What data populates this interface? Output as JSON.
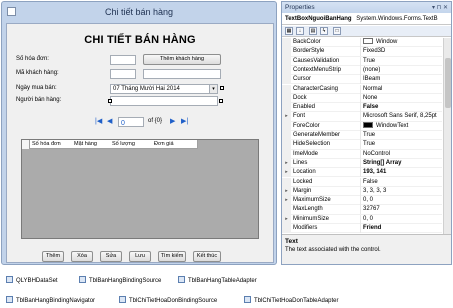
{
  "form": {
    "title": "Chi tiết bán hàng",
    "heading": "CHI TIẾT BÁN HÀNG",
    "labels": {
      "so_hoa_don": "Số hóa đơn:",
      "ma_khach_hang": "Mã khách hàng:",
      "ngay_mua_ban": "Ngày mua bán:",
      "nguoi_ban_hang": "Người bán hàng:"
    },
    "add_customer_button": "Thêm khách hàng",
    "date_value": "07 Tháng Mười Hai 2014",
    "navigator": {
      "position": "0",
      "count": "of {0}"
    },
    "grid_columns": [
      "Số hóa đơn",
      "Mặt hàng",
      "Số lượng",
      "Đơn giá"
    ],
    "buttons": [
      "Thêm",
      "Xóa",
      "Sửa",
      "Lưu",
      "Tìm kiếm",
      "Kết thúc"
    ]
  },
  "tray": {
    "items": [
      "QLYBHDataSet",
      "TblBanHangBindingSource",
      "TblBanHangTableAdapter",
      "TblBanHangBindingNavigator",
      "TblChiTietHoaDonBindingSource",
      "TblChiTietHoaDonTableAdapter"
    ]
  },
  "properties": {
    "title": "Properties",
    "object_name": "TextBoxNguoiBanHang",
    "object_type": "System.Windows.Forms.TextB",
    "rows": [
      {
        "name": "BackColor",
        "value": "Window",
        "swatch": "#ffffff"
      },
      {
        "name": "BorderStyle",
        "value": "Fixed3D"
      },
      {
        "name": "CausesValidation",
        "value": "True"
      },
      {
        "name": "ContextMenuStrip",
        "value": "(none)"
      },
      {
        "name": "Cursor",
        "value": "IBeam"
      },
      {
        "name": "CharacterCasing",
        "value": "Normal"
      },
      {
        "name": "Dock",
        "value": "None"
      },
      {
        "name": "Enabled",
        "value": "False",
        "bold": true
      },
      {
        "name": "Font",
        "value": "Microsoft Sans Serif, 8,25pt",
        "expand": true
      },
      {
        "name": "ForeColor",
        "value": "WindowText",
        "swatch": "#000000"
      },
      {
        "name": "GenerateMember",
        "value": "True"
      },
      {
        "name": "HideSelection",
        "value": "True"
      },
      {
        "name": "ImeMode",
        "value": "NoControl"
      },
      {
        "name": "Lines",
        "value": "String[] Array",
        "bold": true,
        "expand": true
      },
      {
        "name": "Location",
        "value": "193, 141",
        "bold": true,
        "expand": true
      },
      {
        "name": "Locked",
        "value": "False"
      },
      {
        "name": "Margin",
        "value": "3, 3, 3, 3",
        "expand": true
      },
      {
        "name": "MaximumSize",
        "value": "0, 0",
        "expand": true
      },
      {
        "name": "MaxLength",
        "value": "32767"
      },
      {
        "name": "MinimumSize",
        "value": "0, 0",
        "expand": true
      },
      {
        "name": "Modifiers",
        "value": "Friend",
        "bold": true
      }
    ],
    "description_title": "Text",
    "description_text": "The text associated with the control."
  }
}
